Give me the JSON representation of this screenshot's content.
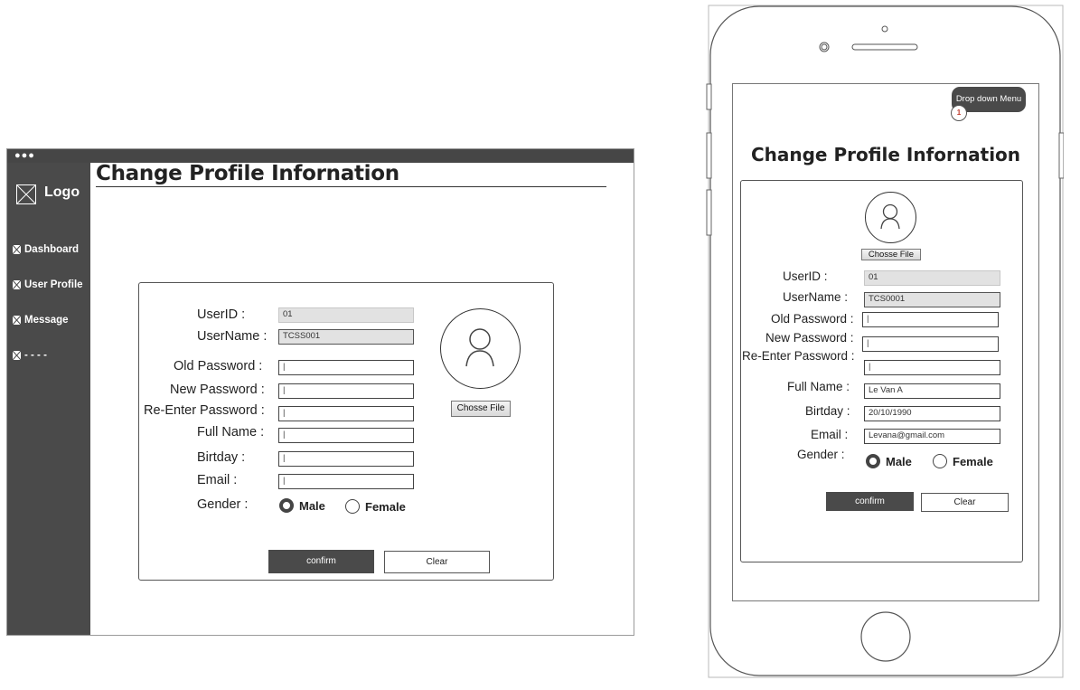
{
  "desktop": {
    "logo": "Logo",
    "nav": [
      "Dashboard",
      "User Profile",
      "Message",
      "- - - -"
    ],
    "title": "Change Profile Infornation",
    "form": {
      "userid_label": "UserID :",
      "userid_value": "01",
      "username_label": "UserName :",
      "username_value": "TCSS001",
      "old_password_label": "Old Password :",
      "new_password_label": "New Password :",
      "reenter_password_label": "Re-Enter Password :",
      "fullname_label": "Full Name :",
      "birthday_label": "Birtday :",
      "email_label": "Email :",
      "gender_label": "Gender :",
      "male": "Male",
      "female": "Female",
      "choose_file": "Chosse File",
      "confirm": "confirm",
      "clear": "Clear"
    }
  },
  "mobile": {
    "dropdown": "Drop down Menu",
    "badge": "1",
    "title": "Change Profile Infornation",
    "form": {
      "choose_file": "Chosse File",
      "userid_label": "UserID :",
      "userid_value": "01",
      "username_label": "UserName :",
      "username_value": "TCS0001",
      "old_password_label": "Old Password :",
      "new_password_label": "New Password :",
      "reenter_password_label": "Re-Enter Password :",
      "fullname_label": "Full Name :",
      "fullname_value": "Le Van A",
      "birthday_label": "Birtday :",
      "birthday_value": "20/10/1990",
      "email_label": "Email :",
      "email_value": "Levana@gmail.com",
      "gender_label": "Gender :",
      "male": "Male",
      "female": "Female",
      "confirm": "confirm",
      "clear": "Clear"
    }
  }
}
